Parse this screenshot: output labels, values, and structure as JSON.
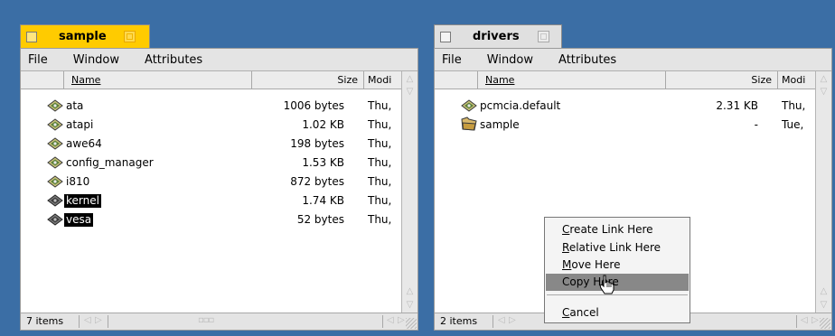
{
  "left_window": {
    "title": "sample",
    "menus": [
      "File",
      "Window",
      "Attributes"
    ],
    "columns": {
      "name": "Name",
      "size": "Size",
      "modified": "Modi"
    },
    "rows": [
      {
        "name": "ata",
        "size": "1006 bytes",
        "modified": "Thu,",
        "selected": false
      },
      {
        "name": "atapi",
        "size": "1.02 KB",
        "modified": "Thu,",
        "selected": false
      },
      {
        "name": "awe64",
        "size": "198 bytes",
        "modified": "Thu,",
        "selected": false
      },
      {
        "name": "config_manager",
        "size": "1.53 KB",
        "modified": "Thu,",
        "selected": false
      },
      {
        "name": "i810",
        "size": "872 bytes",
        "modified": "Thu,",
        "selected": false
      },
      {
        "name": "kernel",
        "size": "1.74 KB",
        "modified": "Thu,",
        "selected": true
      },
      {
        "name": "vesa",
        "size": "52 bytes",
        "modified": "Thu,",
        "selected": true
      }
    ],
    "status": "7 items"
  },
  "right_window": {
    "title": "drivers",
    "menus": [
      "File",
      "Window",
      "Attributes"
    ],
    "columns": {
      "name": "Name",
      "size": "Size",
      "modified": "Modi"
    },
    "rows": [
      {
        "name": "pcmcia.default",
        "size": "2.31 KB",
        "modified": "Thu,",
        "icon": "driver-file-icon"
      },
      {
        "name": "sample",
        "size": "-",
        "modified": "Tue,",
        "icon": "folder-icon"
      }
    ],
    "status": "2 items"
  },
  "context_menu": {
    "items": [
      {
        "prefix": "C",
        "rest": "reate Link Here"
      },
      {
        "prefix": "R",
        "rest": "elative Link Here"
      },
      {
        "prefix": "M",
        "rest": "ove Here"
      },
      {
        "prefix": "Copy Here",
        "rest": "",
        "highlighted": true
      },
      {
        "prefix": "C",
        "rest": "ancel"
      }
    ]
  },
  "colors": {
    "desktop": "#3b6ea5",
    "active_tab": "#ffcb00",
    "menu_highlight": "#888888"
  }
}
